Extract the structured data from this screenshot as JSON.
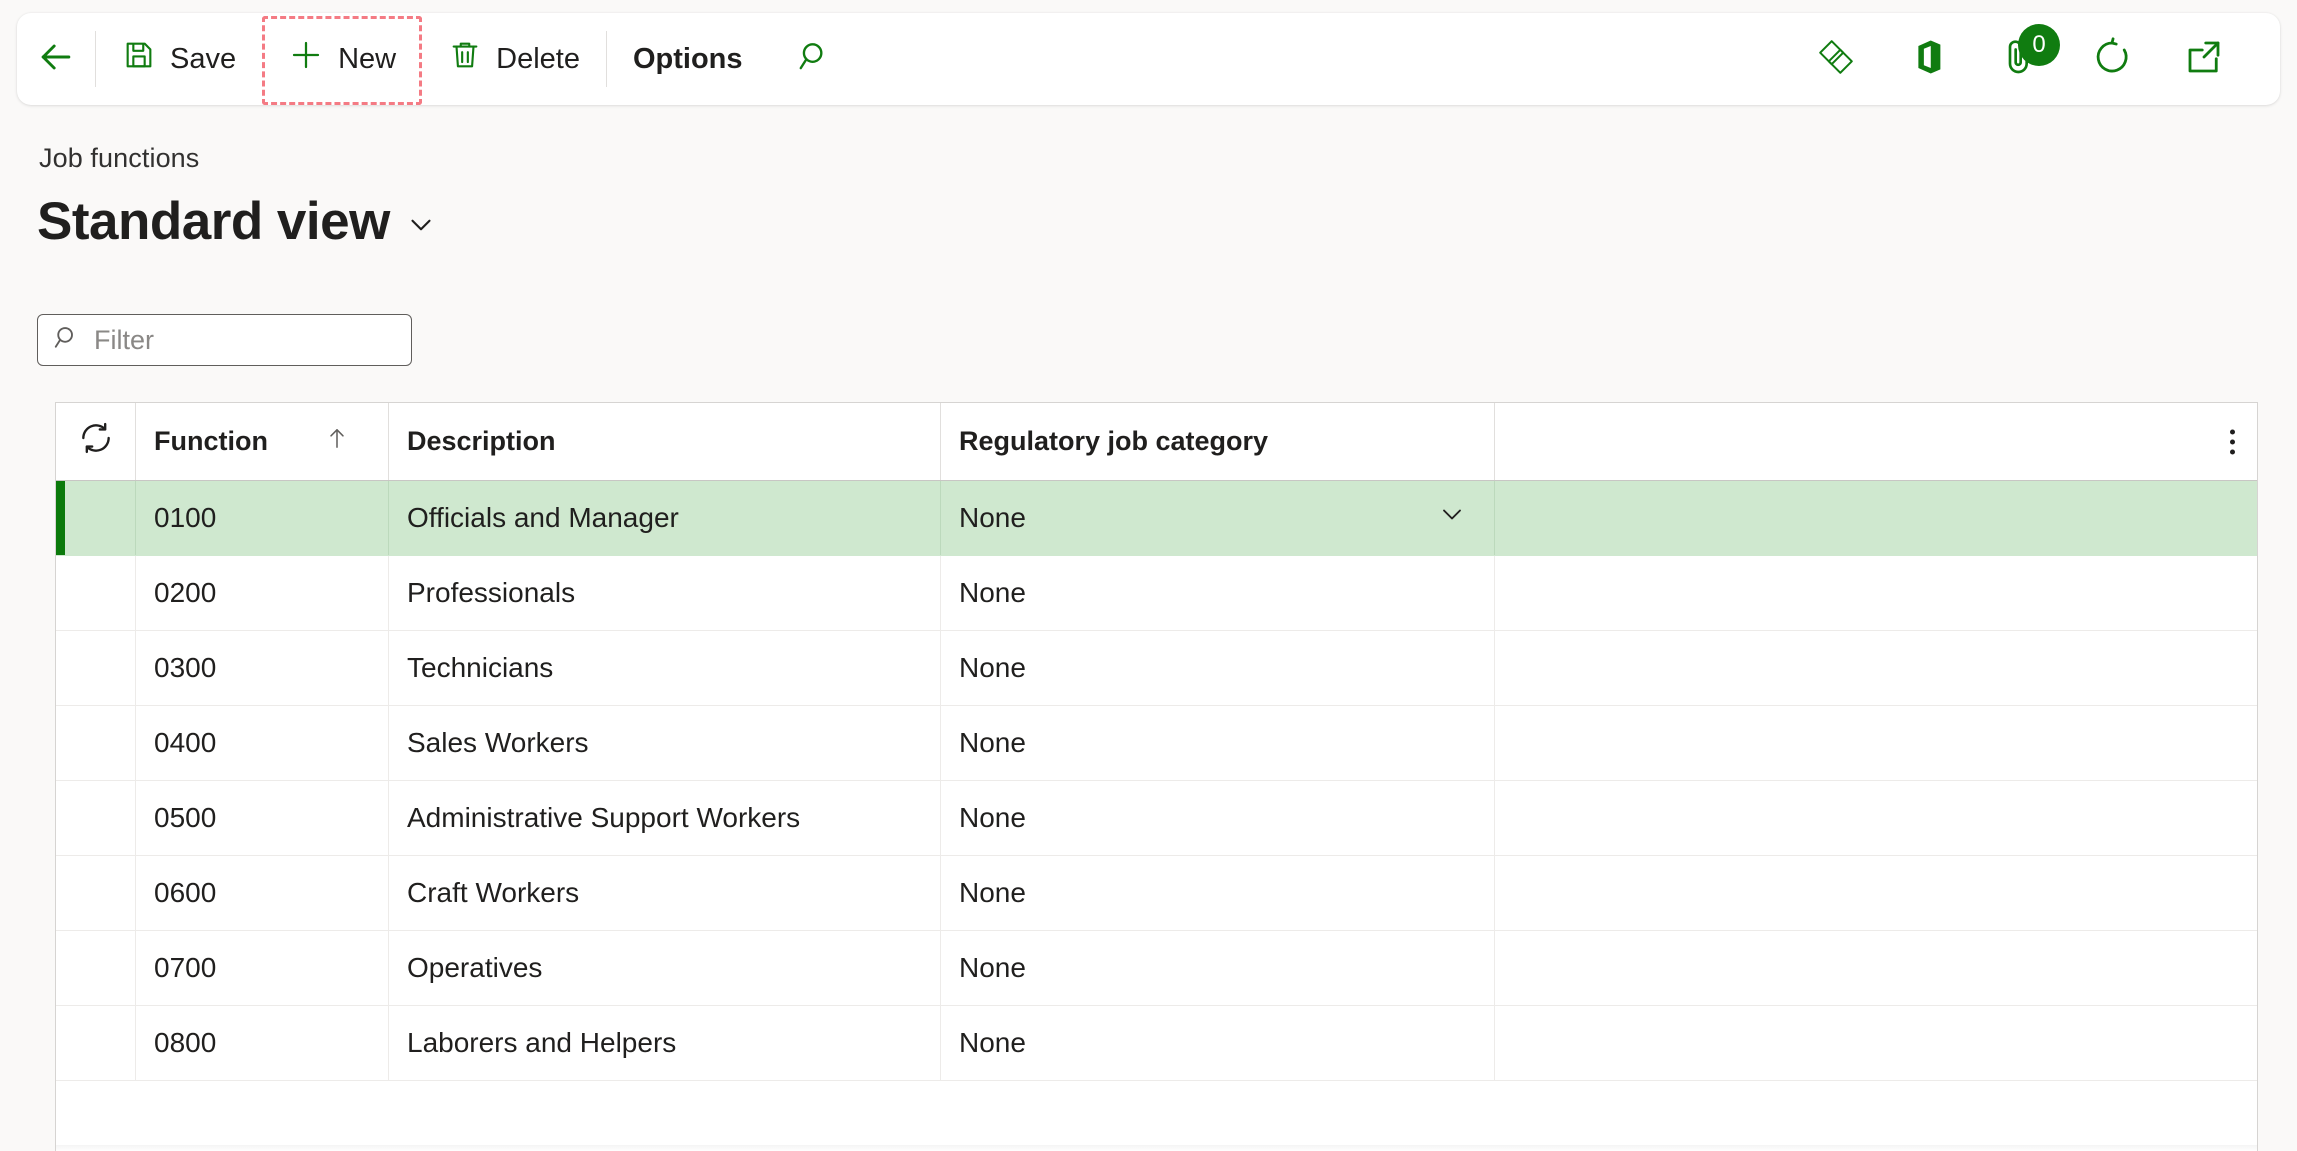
{
  "toolbar": {
    "back_label": "Back",
    "buttons": [
      {
        "id": "save",
        "label": "Save",
        "icon": "save-icon"
      },
      {
        "id": "new",
        "label": "New",
        "icon": "plus-icon",
        "highlighted": true
      },
      {
        "id": "delete",
        "label": "Delete",
        "icon": "trash-icon"
      },
      {
        "id": "options",
        "label": "Options",
        "icon": null
      }
    ],
    "search_label": "Search",
    "right_icons": [
      {
        "id": "power-platform",
        "name": "power-platform-icon"
      },
      {
        "id": "office",
        "name": "office-icon"
      },
      {
        "id": "attachments",
        "name": "attachment-icon",
        "badge": "0"
      },
      {
        "id": "refresh",
        "name": "refresh-icon"
      },
      {
        "id": "open-in-new",
        "name": "open-in-new-window-icon"
      }
    ]
  },
  "header": {
    "breadcrumb": "Job functions",
    "view_title": "Standard view"
  },
  "filter": {
    "placeholder": "Filter",
    "value": ""
  },
  "grid": {
    "columns": [
      {
        "key": "function",
        "label": "Function",
        "sorted": "asc"
      },
      {
        "key": "description",
        "label": "Description"
      },
      {
        "key": "regulatory",
        "label": "Regulatory job category"
      }
    ],
    "rows": [
      {
        "function": "0100",
        "description": "Officials and Manager",
        "regulatory": "None",
        "selected": true
      },
      {
        "function": "0200",
        "description": "Professionals",
        "regulatory": "None",
        "selected": false
      },
      {
        "function": "0300",
        "description": "Technicians",
        "regulatory": "None",
        "selected": false
      },
      {
        "function": "0400",
        "description": "Sales Workers",
        "regulatory": "None",
        "selected": false
      },
      {
        "function": "0500",
        "description": "Administrative Support Workers",
        "regulatory": "None",
        "selected": false
      },
      {
        "function": "0600",
        "description": "Craft Workers",
        "regulatory": "None",
        "selected": false
      },
      {
        "function": "0700",
        "description": "Operatives",
        "regulatory": "None",
        "selected": false
      },
      {
        "function": "0800",
        "description": "Laborers and Helpers",
        "regulatory": "None",
        "selected": false
      }
    ]
  },
  "colors": {
    "accent_green": "#107c10",
    "selected_row": "#cfe8cf",
    "selection_bar": "#0b7a0b",
    "highlight_ring": "#f47b84",
    "page_background": "#faf9f8"
  }
}
